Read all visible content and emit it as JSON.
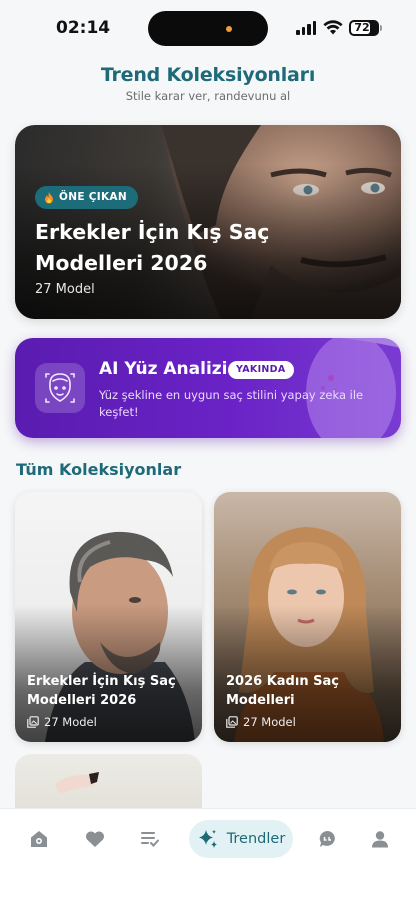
{
  "status_bar": {
    "time": "02:14",
    "battery": "72",
    "battery_level": 0.72
  },
  "header": {
    "title": "Trend Koleksiyonları",
    "subtitle": "Stile karar ver, randevunu al"
  },
  "featured": {
    "badge": "ÖNE ÇIKAN",
    "title": "Erkekler İçin Kış Saç Modelleri 2026",
    "count": "27 Model"
  },
  "ai_card": {
    "title": "AI Yüz Analizi",
    "badge": "YAKINDA",
    "description": "Yüz şekline en uygun saç stilini yapay zeka ile keşfet!"
  },
  "section": {
    "title": "Tüm Koleksiyonlar"
  },
  "collections": [
    {
      "title": "Erkekler İçin Kış Saç Modelleri 2026",
      "count": "27 Model"
    },
    {
      "title": "2026 Kadın Saç Modelleri",
      "count": "27 Model"
    }
  ],
  "nav": {
    "active_label": "Trendler",
    "icons": [
      "home-icon",
      "heart-icon",
      "list-check-icon",
      "sparkles-icon",
      "chat-icon",
      "user-icon"
    ]
  },
  "colors": {
    "accent": "#1f6a78",
    "ai_purple": "#5a1cb0",
    "nav_active_bg": "#e2f2f4"
  }
}
